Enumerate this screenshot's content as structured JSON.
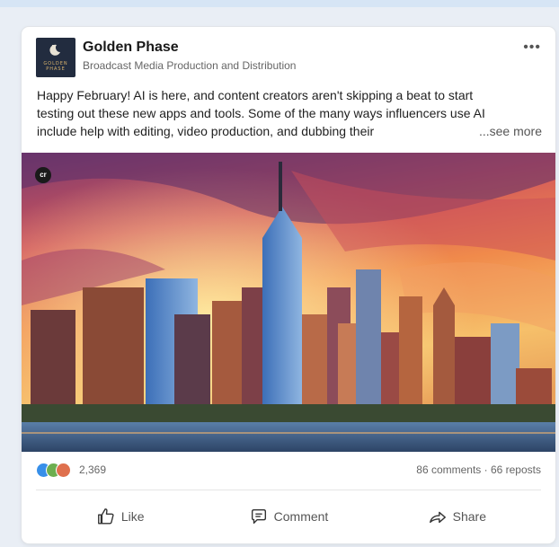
{
  "company": {
    "name": "Golden Phase",
    "tagline": "Broadcast Media Production and Distribution",
    "logo_text": "GOLDEN PHASE"
  },
  "post": {
    "lines": [
      "Happy February! AI is here, and content creators aren't skipping a beat to start",
      "testing out these new apps and tools. Some of the many ways influencers use AI",
      "include help with editing, video production, and dubbing their"
    ],
    "see_more": "...see more",
    "more_menu": "•••",
    "badge": "cr"
  },
  "social": {
    "reaction_count": "2,369",
    "stats": "86 comments · 66 reposts",
    "reactions": [
      "like-icon",
      "clap-icon",
      "love-icon"
    ]
  },
  "actions": [
    {
      "label": "Like",
      "icon": "thumbs-up-icon"
    },
    {
      "label": "Comment",
      "icon": "comment-icon"
    },
    {
      "label": "Share",
      "icon": "share-arrow-icon"
    }
  ],
  "colors": {
    "like": "#378fe9",
    "clap": "#6dae4f",
    "love": "#df704d",
    "logo_bg": "#222c3f"
  }
}
